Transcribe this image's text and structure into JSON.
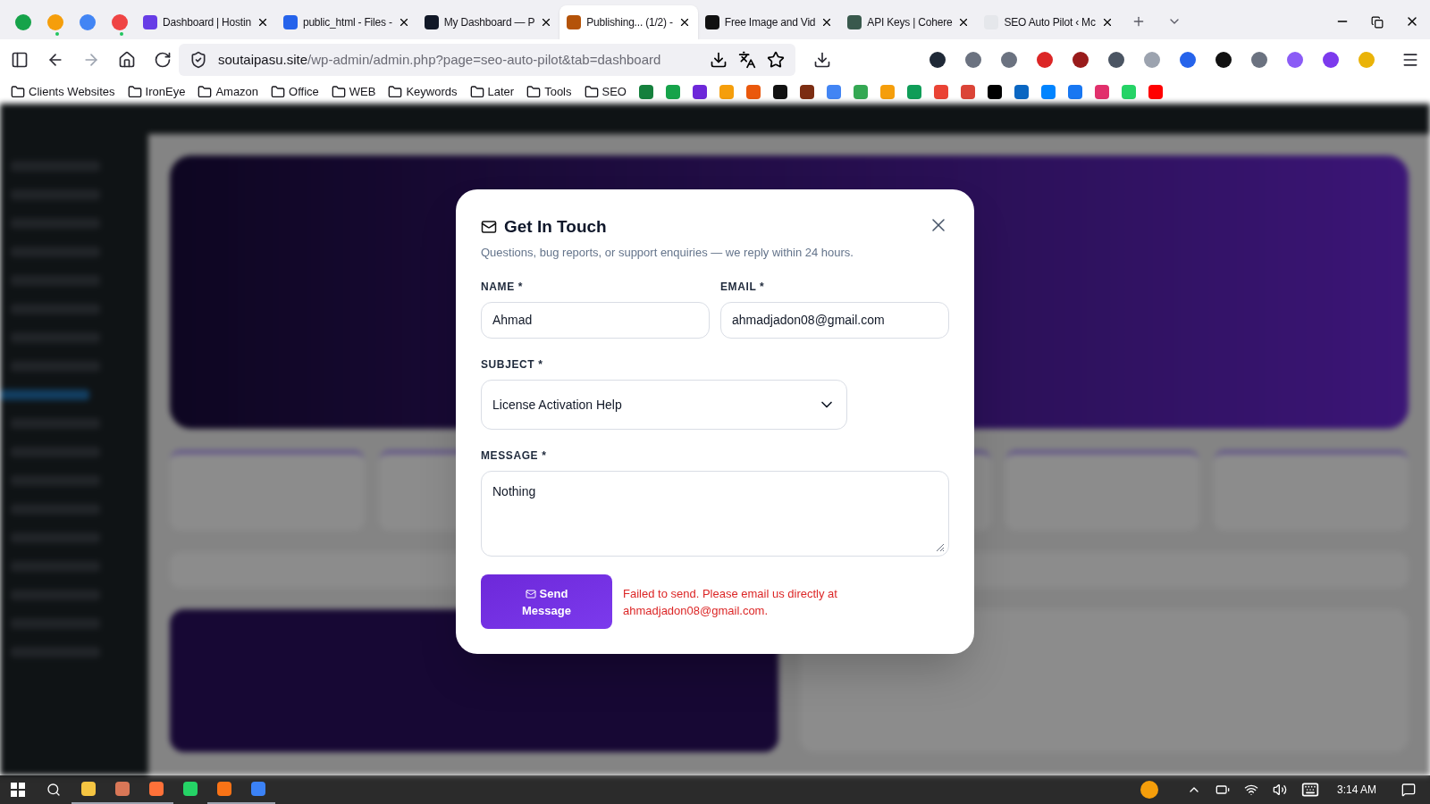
{
  "tabs": [
    {
      "kind": "pinned",
      "color": "#16a34a",
      "attention": false,
      "selected": false
    },
    {
      "kind": "pinned",
      "color": "#f59e0b",
      "attention": true,
      "selected": false
    },
    {
      "kind": "pinned",
      "color": "#4285f4",
      "attention": false,
      "selected": false
    },
    {
      "kind": "pinned",
      "color": "#ef4444",
      "attention": true,
      "selected": false
    },
    {
      "kind": "normal",
      "title": "Dashboard | Hostin",
      "color": "#673de6",
      "selected": false
    },
    {
      "kind": "normal",
      "title": "public_html - Files -",
      "color": "#2563eb",
      "selected": false
    },
    {
      "kind": "normal",
      "title": "My Dashboard — P",
      "color": "#111827",
      "selected": false
    },
    {
      "kind": "normal",
      "title": "Publishing... (1/2) -",
      "color": "#b45309",
      "selected": true
    },
    {
      "kind": "normal",
      "title": "Free Image and Vid",
      "color": "#111111",
      "selected": false
    },
    {
      "kind": "normal",
      "title": "API Keys | Cohere",
      "color": "#39594d",
      "selected": false
    },
    {
      "kind": "normal",
      "title": "SEO Auto Pilot ‹ Mc",
      "color": "#e5e7eb",
      "selected": false
    }
  ],
  "address": {
    "host": "soutaipasu.site",
    "path": "/wp-admin/admin.php?page=seo-auto-pilot&tab=dashboard"
  },
  "extensions": [
    {
      "color": "#1f2937"
    },
    {
      "color": "#6b7280"
    },
    {
      "color": "#6b7280"
    },
    {
      "color": "#dc2626"
    },
    {
      "color": "#991b1b"
    },
    {
      "color": "#4b5563"
    },
    {
      "color": "#9ca3af"
    },
    {
      "color": "#2563eb"
    },
    {
      "color": "#111111"
    },
    {
      "color": "#6b7280"
    },
    {
      "color": "#8b5cf6"
    },
    {
      "color": "#7c3aed"
    },
    {
      "color": "#eab308"
    }
  ],
  "bookmark_folders": [
    "Clients Websites",
    "IronEye",
    "Amazon",
    "Office",
    "WEB",
    "Keywords",
    "Later",
    "Tools",
    "SEO"
  ],
  "bookmark_icons": [
    {
      "color": "#15803d"
    },
    {
      "color": "#16a34a"
    },
    {
      "color": "#6d28d9"
    },
    {
      "color": "#f59e0b"
    },
    {
      "color": "#ea580c"
    },
    {
      "color": "#111111"
    },
    {
      "color": "#7c2d12"
    },
    {
      "color": "#4285f4"
    },
    {
      "color": "#34a853"
    },
    {
      "color": "#f59e0b"
    },
    {
      "color": "#0f9d58"
    },
    {
      "color": "#ea4335"
    },
    {
      "color": "#db4437"
    },
    {
      "color": "#000000"
    },
    {
      "color": "#0a66c2"
    },
    {
      "color": "#0084ff"
    },
    {
      "color": "#1877f2"
    },
    {
      "color": "#e1306c"
    },
    {
      "color": "#25d366"
    },
    {
      "color": "#ff0000"
    }
  ],
  "modal": {
    "title": "Get In Touch",
    "subtitle": "Questions, bug reports, or support enquiries — we reply within 24 hours.",
    "fields": [
      {
        "kind": "input",
        "label": "NAME *",
        "value": "Ahmad"
      },
      {
        "kind": "input",
        "label": "EMAIL *",
        "value": "ahmadjadon08@gmail.com"
      },
      {
        "kind": "select",
        "label": "SUBJECT *",
        "value": "License Activation Help"
      },
      {
        "kind": "textarea",
        "label": "MESSAGE *",
        "value": "Nothing"
      }
    ],
    "send_button": "Send Message",
    "error": "Failed to send. Please email us directly at ahmadjadon08@gmail.com."
  },
  "taskbar": {
    "apps": [
      {
        "color": "#f5c542",
        "running": true
      },
      {
        "color": "#d97757",
        "running": true
      },
      {
        "color": "#ff7139",
        "running": true
      },
      {
        "color": "#25d366",
        "running": false
      },
      {
        "color": "#f97316",
        "running": true
      },
      {
        "color": "#3b82f6",
        "running": true
      }
    ],
    "time": "3:14 AM"
  }
}
